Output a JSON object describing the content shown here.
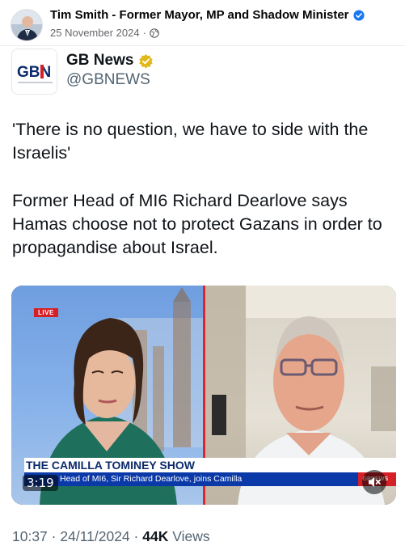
{
  "post": {
    "author": "Tim Smith - Former Mayor, MP and Shadow Minister",
    "date": "25 November 2024",
    "separator": "·",
    "icons": {
      "verified": "verified-badge-icon",
      "privacy": "globe-icon"
    },
    "colors": {
      "verified": "#1877f2",
      "meta": "#65676b"
    }
  },
  "tweet": {
    "name": "GB News",
    "handle": "@GBNEWS",
    "logo_text": "GBN",
    "paragraph_1": "'There is no question, we have to side with the Israelis'",
    "paragraph_2": "Former Head of MI6 Richard Dearlove says Hamas choose not to protect Gazans in order to propagandise about Israel.",
    "time": "10:37",
    "date": "24/11/2024",
    "views_count": "44K",
    "views_label": "Views",
    "icons": {
      "verified": "gold-verified-badge-icon"
    },
    "colors": {
      "gold_badge": "#e2b719",
      "handle": "#536471"
    }
  },
  "video": {
    "live_label": "LIVE",
    "show_title": "THE CAMILLA TOMINEY SHOW",
    "lower_third": "Head of MI6, Sir Richard Dearlove, joins Camilla",
    "channel_tag": "GBNEWS",
    "duration": "3:19",
    "icons": {
      "mute": "muted-speaker-icon"
    },
    "colors": {
      "live": "#d42027",
      "banner": "#0b3aa8",
      "divider": "#e0242a"
    }
  }
}
